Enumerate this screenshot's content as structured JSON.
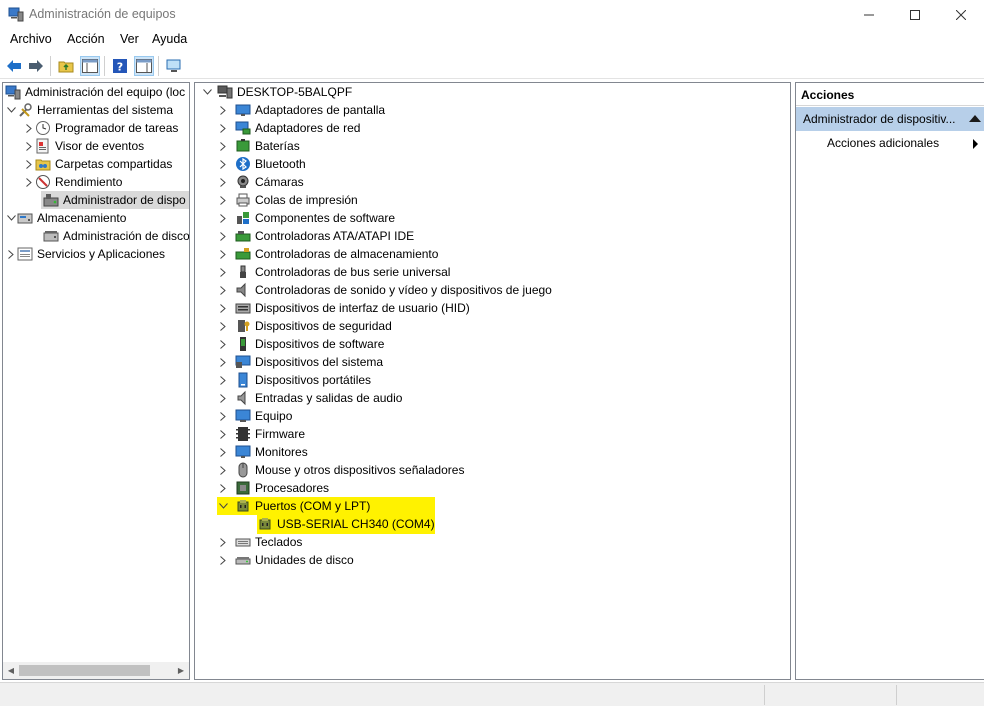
{
  "window": {
    "title": "Administración de equipos"
  },
  "menu": [
    "Archivo",
    "Acción",
    "Ver",
    "Ayuda"
  ],
  "left_tree": {
    "root": "Administración del equipo (loc",
    "system_tools": "Herramientas del sistema",
    "items": [
      "Programador de tareas",
      "Visor de eventos",
      "Carpetas compartidas",
      "Rendimiento",
      "Administrador de dispo"
    ],
    "storage": "Almacenamiento",
    "disk_mgmt": "Administración de disco",
    "services": "Servicios y Aplicaciones"
  },
  "device_tree": {
    "computer": "DESKTOP-5BALQPF",
    "categories": [
      "Adaptadores de pantalla",
      "Adaptadores de red",
      "Baterías",
      "Bluetooth",
      "Cámaras",
      "Colas de impresión",
      "Componentes de software",
      "Controladoras ATA/ATAPI IDE",
      "Controladoras de almacenamiento",
      "Controladoras de bus serie universal",
      "Controladoras de sonido y vídeo y dispositivos de juego",
      "Dispositivos de interfaz de usuario (HID)",
      "Dispositivos de seguridad",
      "Dispositivos de software",
      "Dispositivos del sistema",
      "Dispositivos portátiles",
      "Entradas y salidas de audio",
      "Equipo",
      "Firmware",
      "Monitores",
      "Mouse y otros dispositivos señaladores",
      "Procesadores",
      "Puertos (COM y LPT)"
    ],
    "ports_child": "USB-SERIAL CH340 (COM4)",
    "after": [
      "Teclados",
      "Unidades de disco"
    ]
  },
  "actions": {
    "header": "Acciones",
    "selected": "Administrador de dispositiv...",
    "more": "Acciones adicionales"
  },
  "colors": {
    "highlight": "#fff200",
    "selection": "#b7cfe9",
    "accent_blue": "#1e6fc8"
  }
}
